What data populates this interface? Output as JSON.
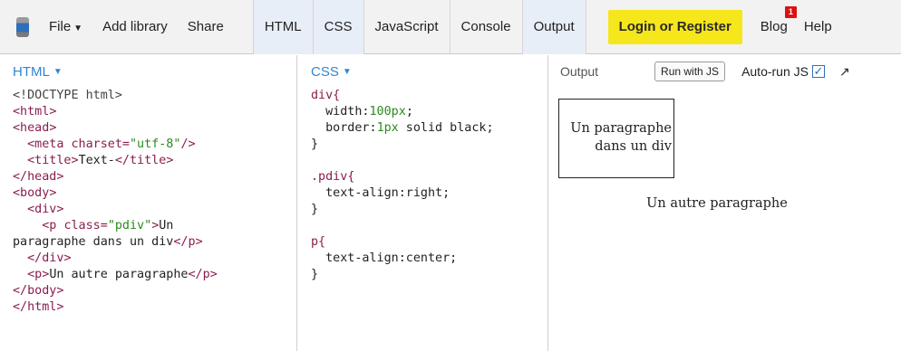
{
  "toolbar": {
    "menu": [
      {
        "label": "File",
        "has_caret": true
      },
      {
        "label": "Add library"
      },
      {
        "label": "Share"
      }
    ],
    "tabs": [
      {
        "label": "HTML"
      },
      {
        "label": "CSS"
      },
      {
        "label": "JavaScript"
      },
      {
        "label": "Console"
      },
      {
        "label": "Output"
      }
    ],
    "login_label": "Login or Register",
    "blog_label": "Blog",
    "blog_badge": "1",
    "help_label": "Help",
    "accent_color": "#f6e61c"
  },
  "panels": {
    "html": {
      "title": "HTML"
    },
    "css": {
      "title": "CSS"
    },
    "output": {
      "title": "Output",
      "run_label": "Run with JS",
      "autorun_label": "Auto-run JS"
    }
  },
  "html_code": [
    "<!DOCTYPE html>",
    "<html>",
    "<head>",
    "  <meta charset=\"utf-8\"/>",
    "  <title>Text-</title>",
    "</head>",
    "<body>",
    "  <div>",
    "    <p class=\"pdiv\">Un",
    "paragraphe dans un div</p>",
    "  </div>",
    "  <p>Un autre paragraphe</p>",
    "</body>",
    "</html>"
  ],
  "css_code": [
    "div{",
    "  width:100px;",
    "  border:1px solid black;",
    "}",
    "",
    ".pdiv{",
    "  text-align:right;",
    "}",
    "",
    "p{",
    "  text-align:center;",
    "}"
  ],
  "output": {
    "para1_line1": "Un paragraphe",
    "para1_line2": "dans un div",
    "para2": "Un autre paragraphe"
  }
}
